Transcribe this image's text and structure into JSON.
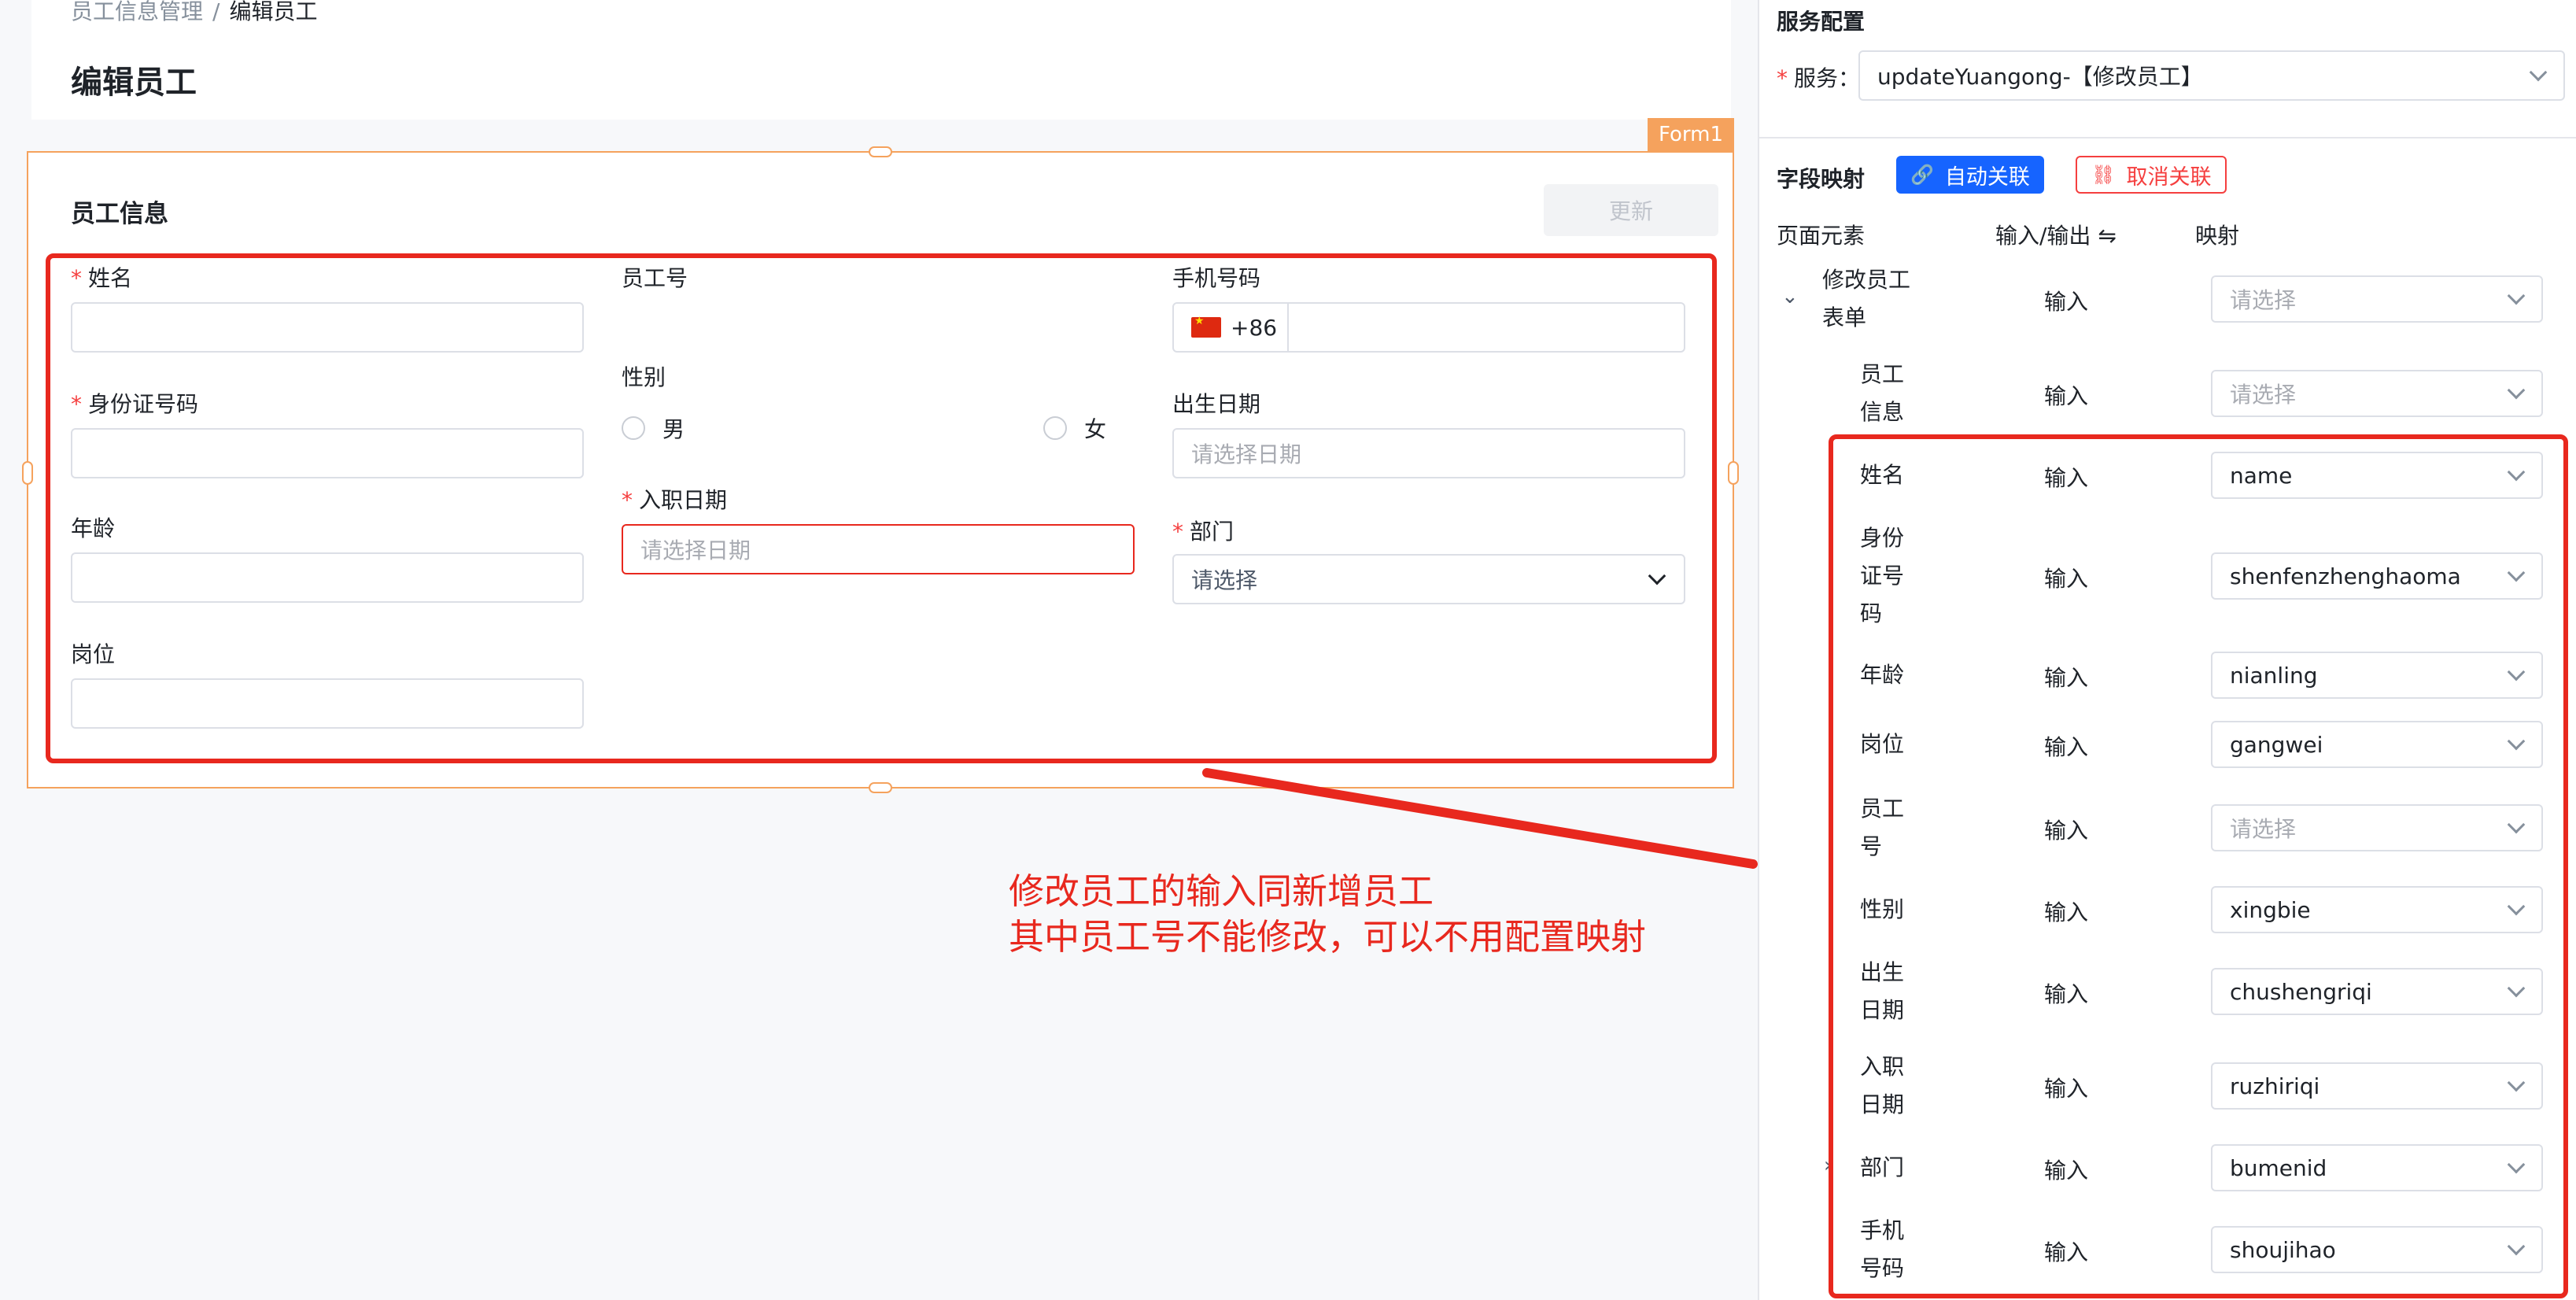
{
  "breadcrumb": {
    "parent": "员工信息管理",
    "separator": "/",
    "current": "编辑员工"
  },
  "page_title": "编辑员工",
  "form": {
    "tag": "Form1",
    "section_title": "员工信息",
    "update_label": "更新",
    "fields": {
      "name": {
        "label": "姓名",
        "required": "*"
      },
      "id_card": {
        "label": "身份证号码",
        "required": "*"
      },
      "age": {
        "label": "年龄"
      },
      "position": {
        "label": "岗位"
      },
      "emp_no": {
        "label": "员工号"
      },
      "gender": {
        "label": "性别",
        "options": [
          "男",
          "女"
        ]
      },
      "hire_date": {
        "label": "入职日期",
        "required": "*",
        "placeholder": "请选择日期"
      },
      "phone": {
        "label": "手机号码",
        "prefix": "+86"
      },
      "birth_date": {
        "label": "出生日期",
        "placeholder": "请选择日期"
      },
      "department": {
        "label": "部门",
        "required": "*",
        "placeholder": "请选择"
      }
    }
  },
  "annotation": {
    "line1": "修改员工的输入同新增员工",
    "line2": "其中员工号不能修改，可以不用配置映射"
  },
  "panel": {
    "title": "服务配置",
    "service_label": "服务：",
    "service_required": "*",
    "service_value": "updateYuangong-【修改员工】",
    "mapping_title": "字段映射",
    "auto_link": "自动关联",
    "cancel_link": "取消关联",
    "columns": {
      "element": "页面元素",
      "io": "输入/输出 ⇋",
      "mapping": "映射"
    },
    "rows": [
      {
        "label": "修改员工表单",
        "lines": [
          "修改员工",
          "表单"
        ],
        "io": "输入",
        "value": "请选择",
        "placeholder": true,
        "toggle": "⌄"
      },
      {
        "label": "员工信息",
        "lines": [
          "员工",
          "信息"
        ],
        "io": "输入",
        "value": "请选择",
        "placeholder": true
      },
      {
        "label": "姓名",
        "lines": [
          "姓名"
        ],
        "io": "输入",
        "value": "name"
      },
      {
        "label": "身份证号码",
        "lines": [
          "身份",
          "证号",
          "码"
        ],
        "io": "输入",
        "value": "shenfenzhenghaoma"
      },
      {
        "label": "年龄",
        "lines": [
          "年龄"
        ],
        "io": "输入",
        "value": "nianling"
      },
      {
        "label": "岗位",
        "lines": [
          "岗位"
        ],
        "io": "输入",
        "value": "gangwei"
      },
      {
        "label": "员工号",
        "lines": [
          "员工",
          "号"
        ],
        "io": "输入",
        "value": "请选择",
        "placeholder": true
      },
      {
        "label": "性别",
        "lines": [
          "性别"
        ],
        "io": "输入",
        "value": "xingbie"
      },
      {
        "label": "出生日期",
        "lines": [
          "出生",
          "日期"
        ],
        "io": "输入",
        "value": "chushengriqi"
      },
      {
        "label": "入职日期",
        "lines": [
          "入职",
          "日期"
        ],
        "io": "输入",
        "value": "ruzhiriqi"
      },
      {
        "label": "部门",
        "lines": [
          "部门"
        ],
        "io": "输入",
        "value": "bumenid",
        "toggle": "›"
      },
      {
        "label": "手机号码",
        "lines": [
          "手机",
          "号码"
        ],
        "io": "输入",
        "value": "shoujihao"
      }
    ]
  }
}
